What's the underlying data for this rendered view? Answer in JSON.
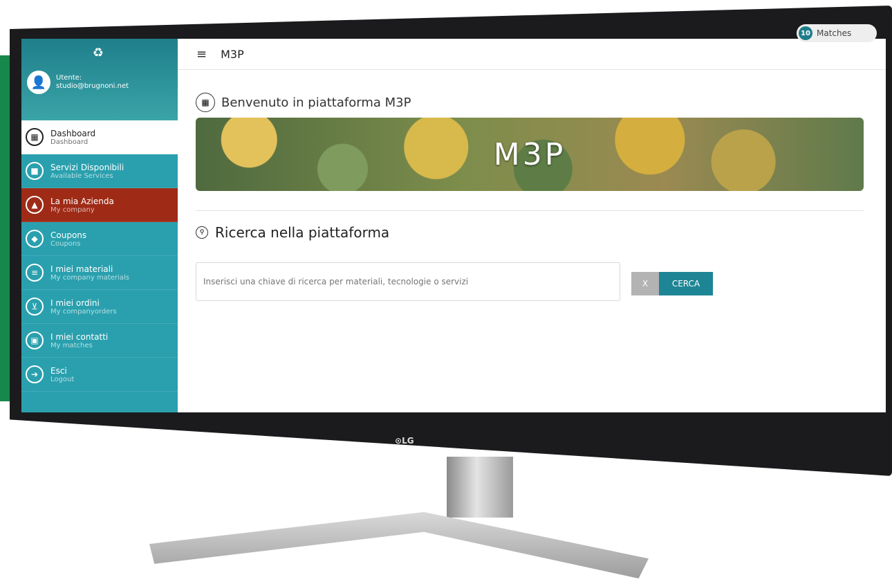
{
  "app": {
    "title": "M3P",
    "matches_count": "10",
    "matches_label": "Matches"
  },
  "user": {
    "label": "Utente:",
    "email": "studio@brugnoni.net"
  },
  "sidebar": {
    "items": [
      {
        "title": "Dashboard",
        "subtitle": "Dashboard",
        "icon": "dashboard-icon"
      },
      {
        "title": "Servizi Disponibili",
        "subtitle": "Available Services",
        "icon": "briefcase-icon"
      },
      {
        "title": "La mia Azienda",
        "subtitle": "My company",
        "icon": "warning-icon"
      },
      {
        "title": "Coupons",
        "subtitle": "Coupons",
        "icon": "tag-icon"
      },
      {
        "title": "I miei materiali",
        "subtitle": "My company materials",
        "icon": "list-icon"
      },
      {
        "title": "I miei ordini",
        "subtitle": "My companyorders",
        "icon": "cart-icon"
      },
      {
        "title": "I miei contatti",
        "subtitle": "My matches",
        "icon": "contact-icon"
      },
      {
        "title": "Esci",
        "subtitle": "Logout",
        "icon": "logout-icon"
      }
    ]
  },
  "main": {
    "welcome": "Benvenuto in piattaforma M3P",
    "banner_text": "M3P",
    "search_title": "Ricerca nella piattaforma",
    "search_placeholder": "Inserisci una chiave di ricerca per materiali, tecnologie o servizi",
    "clear_label": "X",
    "search_button": "CERCA"
  },
  "device": {
    "brand": "LG"
  },
  "colors": {
    "sidebar": "#2aa0ae",
    "alert": "#9f2b17",
    "accent": "#1e8595",
    "green": "#17884b"
  }
}
